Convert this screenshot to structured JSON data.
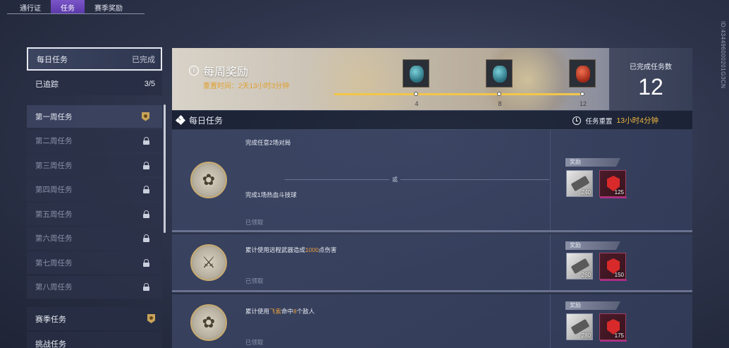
{
  "top_tabs": [
    {
      "label": "通行证",
      "active": false
    },
    {
      "label": "任务",
      "active": true
    },
    {
      "label": "赛季奖励",
      "active": false
    }
  ],
  "watermark": "ID:434496000201G3CN",
  "sidebar": {
    "daily": {
      "label": "每日任务",
      "status": "已完成"
    },
    "tracked": {
      "label": "已追踪",
      "count": "3/5"
    },
    "weeks": [
      {
        "label": "第一周任务",
        "icon": "badge-icon",
        "active": true
      },
      {
        "label": "第二周任务",
        "icon": "lock-icon",
        "active": false
      },
      {
        "label": "第三周任务",
        "icon": "lock-icon",
        "active": false
      },
      {
        "label": "第四周任务",
        "icon": "lock-icon",
        "active": false
      },
      {
        "label": "第五周任务",
        "icon": "lock-icon",
        "active": false
      },
      {
        "label": "第六周任务",
        "icon": "lock-icon",
        "active": false
      },
      {
        "label": "第七周任务",
        "icon": "lock-icon",
        "active": false
      },
      {
        "label": "第八周任务",
        "icon": "lock-icon",
        "active": false
      }
    ],
    "season": {
      "label": "赛季任务"
    },
    "challenge": {
      "label": "挑战任务"
    }
  },
  "weekly_reward": {
    "title": "每周奖励",
    "reset_label": "重置时间：",
    "reset_time": "2天13小时3分钟",
    "progress_fraction": 1.0,
    "milestones": [
      {
        "value": "4",
        "chest": "teal"
      },
      {
        "value": "8",
        "chest": "teal"
      },
      {
        "value": "12",
        "chest": "red"
      }
    ],
    "completed_label": "已完成任务数",
    "completed_count": "12"
  },
  "daily": {
    "title": "每日任务",
    "reset_label": "任务重置",
    "reset_time": "13小时4分钟"
  },
  "tasks": [
    {
      "icon": "flower-icon",
      "line1": "完成任意2场对局",
      "or": "或",
      "line2": "完成1场热血斗技球",
      "status": "已领取",
      "reward_label": "奖励",
      "rewards": [
        {
          "type": "white",
          "qty": "240"
        },
        {
          "type": "red",
          "qty": "125"
        }
      ]
    },
    {
      "icon": "crossed-swords-icon",
      "line1_pre": "累计使用远程武器造成",
      "line1_hl": "1000",
      "line1_post": "点伤害",
      "status": "已领取",
      "reward_label": "奖励",
      "rewards": [
        {
          "type": "white",
          "qty": "260"
        },
        {
          "type": "red",
          "qty": "150"
        }
      ]
    },
    {
      "icon": "flower-icon",
      "line1_pre": "累计使用",
      "line1_hl": "飞索",
      "line1_mid": "命中",
      "line1_hl2": "8",
      "line1_post": "个敌人",
      "status": "已领取",
      "reward_label": "奖励",
      "rewards": [
        {
          "type": "white",
          "qty": "280"
        },
        {
          "type": "red",
          "qty": "175"
        }
      ]
    }
  ]
}
